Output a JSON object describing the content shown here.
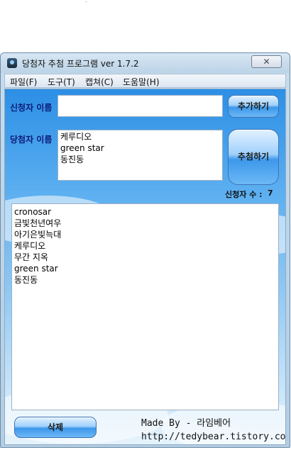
{
  "window": {
    "title": "당첨자 추첨 프로그램 ver 1.7.2",
    "close_glyph": "✕"
  },
  "menu": [
    "파일(F)",
    "도구(T)",
    "캡쳐(C)",
    "도움말(H)"
  ],
  "form": {
    "applicant_label": "신청자 이름",
    "applicant_value": "",
    "winner_label": "당첨자 이름",
    "winners": [
      "케루디오",
      "green star",
      "동진동"
    ],
    "add_button": "추가하기",
    "draw_button": "추첨하기",
    "count_label": "신청자 수 :",
    "count_value": "7"
  },
  "applicants": [
    "cronosar",
    "금빛천년여우",
    "아기은빛늑대",
    "케루디오",
    "무간 지옥",
    "green star",
    "동진동"
  ],
  "footer": {
    "delete_button": "삭제",
    "made_by": "Made By - 라임베어",
    "url": "http://tedybear.tistory.com"
  },
  "icons": {
    "app": "app-icon",
    "close": "close-icon"
  },
  "colors": {
    "label": "#0d1b7a",
    "client_top": "#2c8fe5",
    "client_bottom": "#e6f3fc",
    "button": "#3d98ea"
  }
}
